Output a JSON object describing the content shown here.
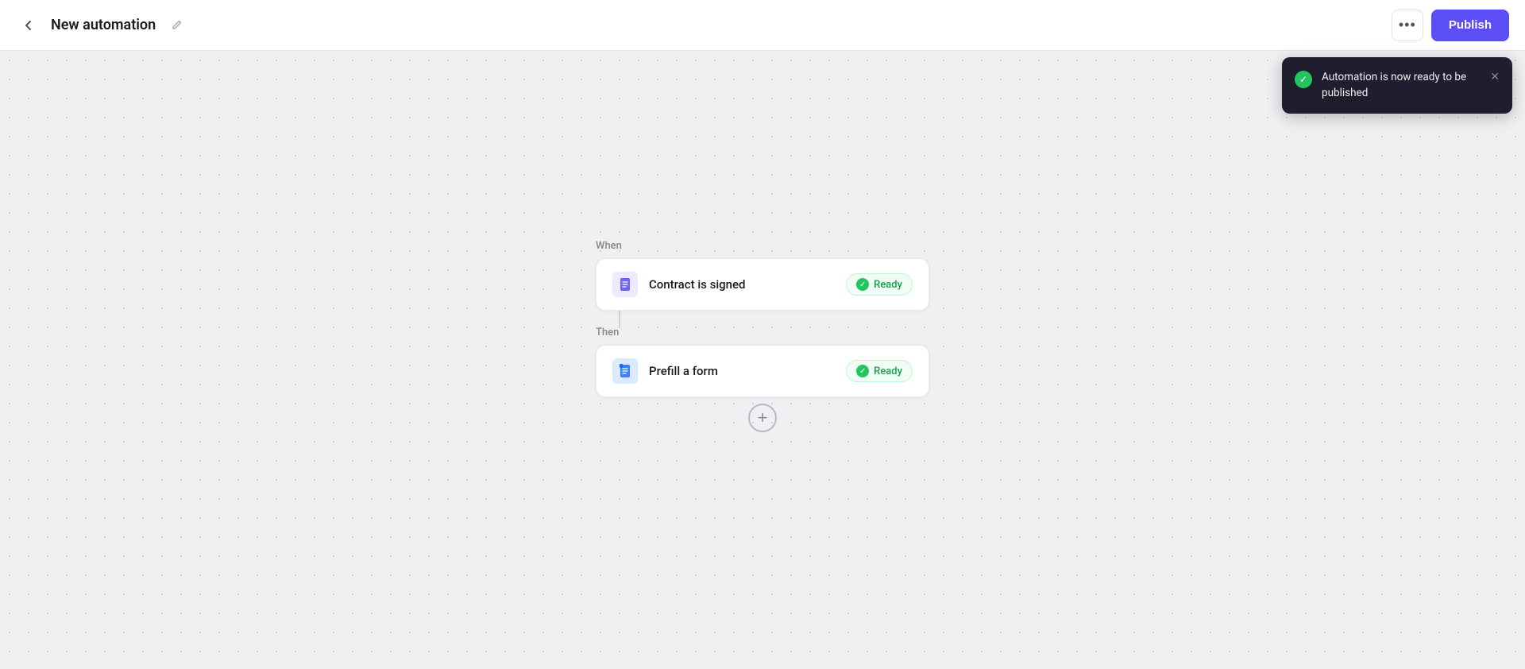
{
  "header": {
    "back_label": "‹",
    "title": "New automation",
    "edit_icon": "✎",
    "more_label": "•••",
    "publish_label": "Publish"
  },
  "flow": {
    "when_label": "When",
    "then_label": "Then",
    "step1": {
      "icon": "📄",
      "title": "Contract is signed",
      "status": "Ready"
    },
    "step2": {
      "icon": "📋",
      "title": "Prefill a form",
      "status": "Ready"
    },
    "add_label": "+"
  },
  "toast": {
    "message": "Automation is now ready to be published",
    "close_label": "✕"
  }
}
